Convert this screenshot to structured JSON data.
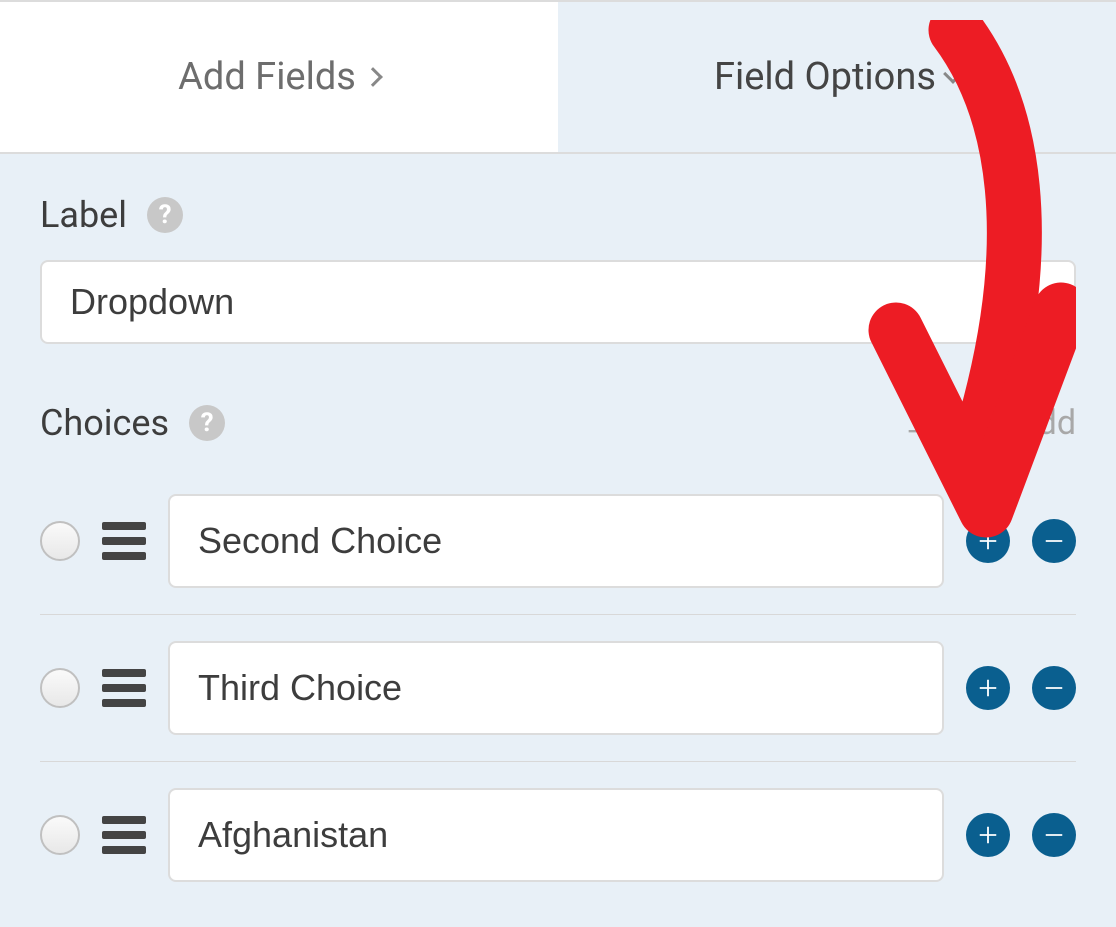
{
  "tabs": {
    "add_fields": "Add Fields",
    "field_options": "Field Options"
  },
  "label_section": {
    "label": "Label",
    "value": "Dropdown"
  },
  "choices_section": {
    "label": "Choices",
    "bulk_label": "Bulk Add"
  },
  "choices": [
    {
      "value": "Second Choice"
    },
    {
      "value": "Third Choice"
    },
    {
      "value": "Afghanistan"
    }
  ],
  "colors": {
    "accent": "#0a5f8f",
    "annotation": "#ed1c24"
  }
}
